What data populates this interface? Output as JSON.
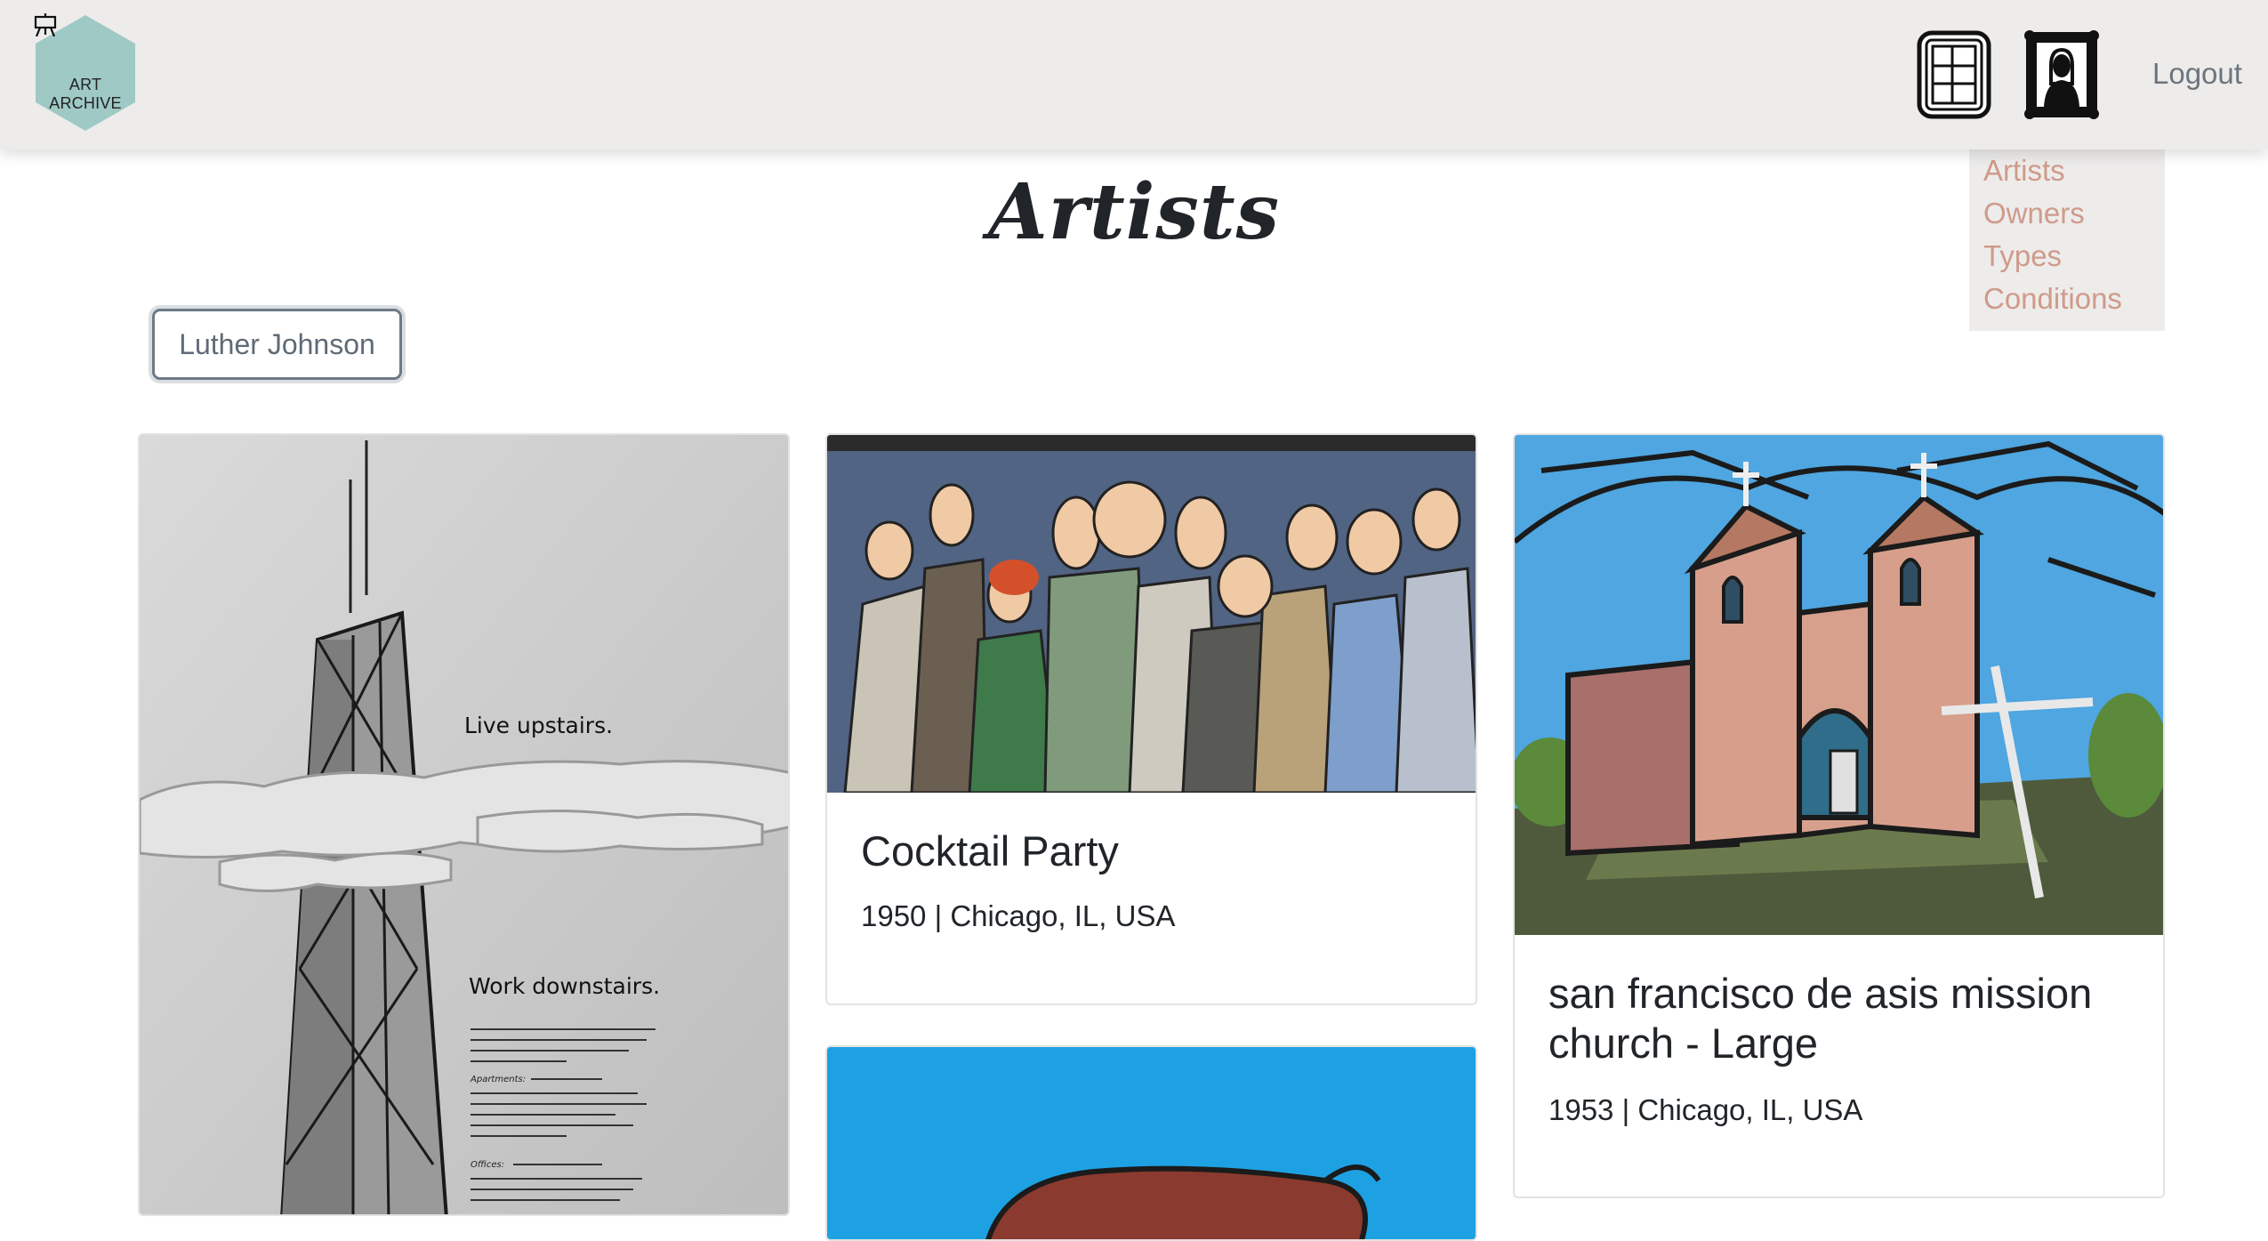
{
  "header": {
    "logo_label": "ART ARCHIVE",
    "logout_label": "Logout",
    "icons": [
      "artworks-frame-icon",
      "portrait-frame-icon"
    ]
  },
  "menu": {
    "items": [
      {
        "label": "Artists"
      },
      {
        "label": "Owners"
      },
      {
        "label": "Types"
      },
      {
        "label": "Conditions"
      }
    ]
  },
  "page": {
    "title": "Artists",
    "filter_label": "Luther Johnson"
  },
  "artworks": [
    {
      "image_text_1": "Live upstairs.",
      "image_text_2": "Work downstairs.",
      "image_text_3": "Apartments:",
      "image_text_4": "Offices:"
    },
    {
      "title": "Cocktail Party",
      "meta": "1950 | Chicago, IL, USA"
    },
    {
      "title": "san francisco de asis mission church - Large",
      "meta": "1953 | Chicago, IL, USA"
    }
  ],
  "colors": {
    "navbar_bg": "#edeceb",
    "menu_link": "#d09a8a",
    "logo_hex": "#9fc9c5"
  }
}
